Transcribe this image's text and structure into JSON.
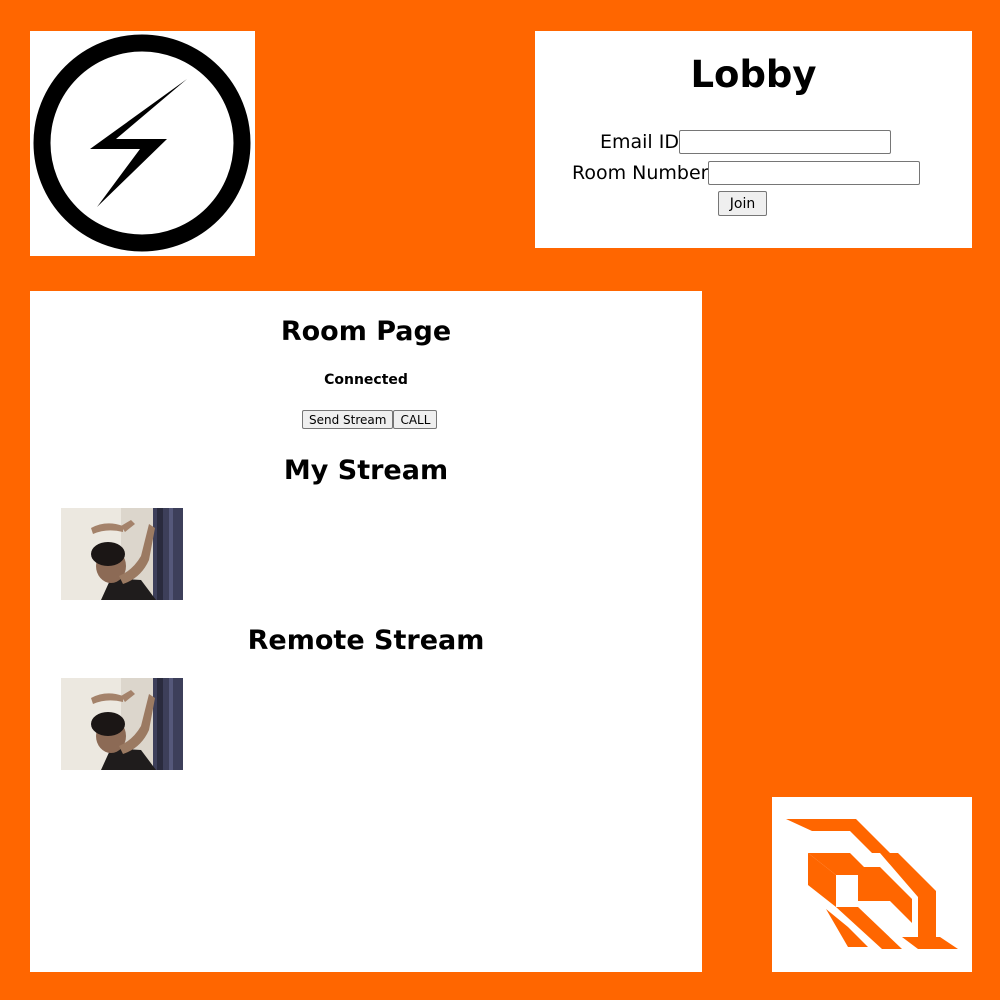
{
  "logos": {
    "socketio": "socketio-logo",
    "websocket": "websocket-logo",
    "accent_color": "#ff6600"
  },
  "lobby": {
    "title": "Lobby",
    "email_label": "Email ID",
    "email_value": "",
    "room_label": "Room Number",
    "room_value": "",
    "join_label": "Join"
  },
  "room": {
    "title": "Room Page",
    "status": "Connected",
    "send_stream_label": "Send Stream",
    "call_label": "CALL",
    "my_stream_title": "My Stream",
    "remote_stream_title": "Remote Stream"
  }
}
